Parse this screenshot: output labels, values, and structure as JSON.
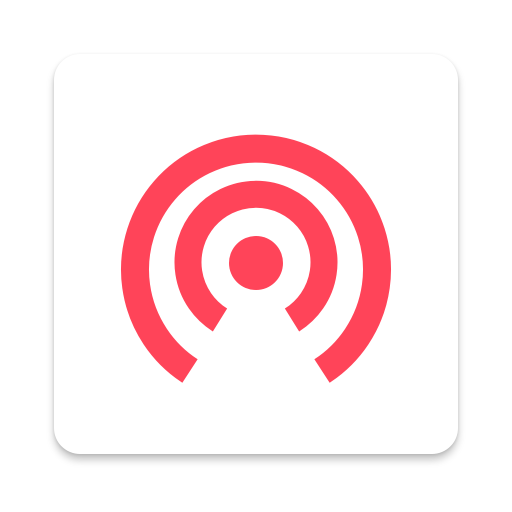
{
  "app_icon": {
    "icon": "broadcast-signal-icon",
    "colors": {
      "accent": "#ff4459",
      "tile": "#ffffff"
    }
  }
}
